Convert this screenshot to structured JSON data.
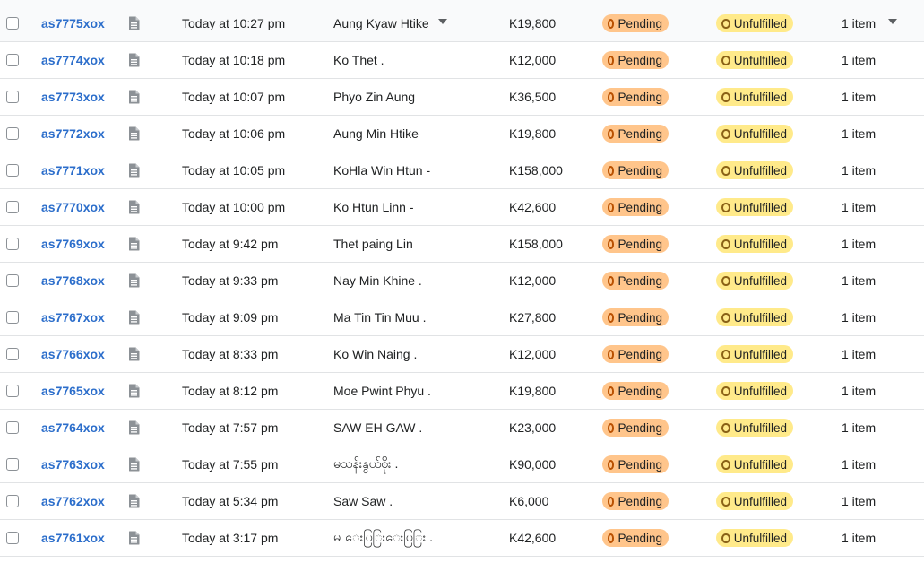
{
  "colors": {
    "order_link": "#2c6ecb",
    "pending_bg": "#ffc58b",
    "unfulfilled_bg": "#ffea8a",
    "row_border": "#e1e3e5"
  },
  "icons": {
    "note": "note-icon",
    "customer_caret": "chevron-down-icon",
    "items_caret": "chevron-down-icon"
  },
  "orders": [
    {
      "id": "as7775xox",
      "date": "Today at 10:27 pm",
      "customer": "Aung Kyaw Htike",
      "total": "K19,800",
      "payment": "Pending",
      "fulfillment": "Unfulfilled",
      "items": "1 item"
    },
    {
      "id": "as7774xox",
      "date": "Today at 10:18 pm",
      "customer": "Ko Thet .",
      "total": "K12,000",
      "payment": "Pending",
      "fulfillment": "Unfulfilled",
      "items": "1 item"
    },
    {
      "id": "as7773xox",
      "date": "Today at 10:07 pm",
      "customer": "Phyo Zin Aung",
      "total": "K36,500",
      "payment": "Pending",
      "fulfillment": "Unfulfilled",
      "items": "1 item"
    },
    {
      "id": "as7772xox",
      "date": "Today at 10:06 pm",
      "customer": "Aung Min Htike",
      "total": "K19,800",
      "payment": "Pending",
      "fulfillment": "Unfulfilled",
      "items": "1 item"
    },
    {
      "id": "as7771xox",
      "date": "Today at 10:05 pm",
      "customer": "KoHla Win Htun -",
      "total": "K158,000",
      "payment": "Pending",
      "fulfillment": "Unfulfilled",
      "items": "1 item"
    },
    {
      "id": "as7770xox",
      "date": "Today at 10:00 pm",
      "customer": "Ko Htun Linn -",
      "total": "K42,600",
      "payment": "Pending",
      "fulfillment": "Unfulfilled",
      "items": "1 item"
    },
    {
      "id": "as7769xox",
      "date": "Today at 9:42 pm",
      "customer": "Thet paing Lin",
      "total": "K158,000",
      "payment": "Pending",
      "fulfillment": "Unfulfilled",
      "items": "1 item"
    },
    {
      "id": "as7768xox",
      "date": "Today at 9:33 pm",
      "customer": "Nay Min Khine .",
      "total": "K12,000",
      "payment": "Pending",
      "fulfillment": "Unfulfilled",
      "items": "1 item"
    },
    {
      "id": "as7767xox",
      "date": "Today at 9:09 pm",
      "customer": "Ma Tin Tin Muu .",
      "total": "K27,800",
      "payment": "Pending",
      "fulfillment": "Unfulfilled",
      "items": "1 item"
    },
    {
      "id": "as7766xox",
      "date": "Today at 8:33 pm",
      "customer": "Ko Win Naing .",
      "total": "K12,000",
      "payment": "Pending",
      "fulfillment": "Unfulfilled",
      "items": "1 item"
    },
    {
      "id": "as7765xox",
      "date": "Today at 8:12 pm",
      "customer": "Moe Pwint Phyu .",
      "total": "K19,800",
      "payment": "Pending",
      "fulfillment": "Unfulfilled",
      "items": "1 item"
    },
    {
      "id": "as7764xox",
      "date": "Today at 7:57 pm",
      "customer": "SAW EH GAW .",
      "total": "K23,000",
      "payment": "Pending",
      "fulfillment": "Unfulfilled",
      "items": "1 item"
    },
    {
      "id": "as7763xox",
      "date": "Today at 7:55 pm",
      "customer": "မသန်းနွယ်စိုး .",
      "total": "K90,000",
      "payment": "Pending",
      "fulfillment": "Unfulfilled",
      "items": "1 item"
    },
    {
      "id": "as7762xox",
      "date": "Today at 5:34 pm",
      "customer": "Saw Saw .",
      "total": "K6,000",
      "payment": "Pending",
      "fulfillment": "Unfulfilled",
      "items": "1 item"
    },
    {
      "id": "as7761xox",
      "date": "Today at 3:17 pm",
      "customer": "မ ေးပြြးေးပြြး .",
      "total": "K42,600",
      "payment": "Pending",
      "fulfillment": "Unfulfilled",
      "items": "1 item"
    }
  ]
}
